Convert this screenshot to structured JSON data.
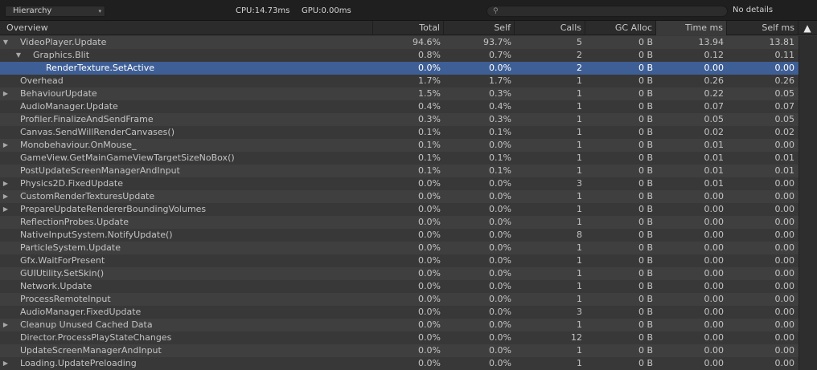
{
  "toolbar": {
    "view_mode": "Hierarchy",
    "cpu": "CPU:14.73ms",
    "gpu": "GPU:0.00ms",
    "search_value": "",
    "details": "No details"
  },
  "columns": {
    "overview": "Overview",
    "total": "Total",
    "self": "Self",
    "calls": "Calls",
    "gc_alloc": "GC Alloc",
    "time_ms": "Time ms",
    "self_ms": "Self ms"
  },
  "rows": [
    {
      "name": "VideoPlayer.Update",
      "depth": 0,
      "foldout": "expanded",
      "total": "94.6%",
      "self": "93.7%",
      "calls": "5",
      "gc": "0 B",
      "time": "13.94",
      "selfms": "13.81"
    },
    {
      "name": "Graphics.Blit",
      "depth": 1,
      "foldout": "expanded",
      "total": "0.8%",
      "self": "0.7%",
      "calls": "2",
      "gc": "0 B",
      "time": "0.12",
      "selfms": "0.11"
    },
    {
      "name": "RenderTexture.SetActive",
      "depth": 2,
      "foldout": "none",
      "total": "0.0%",
      "self": "0.0%",
      "calls": "2",
      "gc": "0 B",
      "time": "0.00",
      "selfms": "0.00",
      "selected": true
    },
    {
      "name": "Overhead",
      "depth": 0,
      "foldout": "none",
      "total": "1.7%",
      "self": "1.7%",
      "calls": "1",
      "gc": "0 B",
      "time": "0.26",
      "selfms": "0.26"
    },
    {
      "name": "BehaviourUpdate",
      "depth": 0,
      "foldout": "collapsed",
      "total": "1.5%",
      "self": "0.3%",
      "calls": "1",
      "gc": "0 B",
      "time": "0.22",
      "selfms": "0.05"
    },
    {
      "name": "AudioManager.Update",
      "depth": 0,
      "foldout": "none",
      "total": "0.4%",
      "self": "0.4%",
      "calls": "1",
      "gc": "0 B",
      "time": "0.07",
      "selfms": "0.07"
    },
    {
      "name": "Profiler.FinalizeAndSendFrame",
      "depth": 0,
      "foldout": "none",
      "total": "0.3%",
      "self": "0.3%",
      "calls": "1",
      "gc": "0 B",
      "time": "0.05",
      "selfms": "0.05"
    },
    {
      "name": "Canvas.SendWillRenderCanvases()",
      "depth": 0,
      "foldout": "none",
      "total": "0.1%",
      "self": "0.1%",
      "calls": "1",
      "gc": "0 B",
      "time": "0.02",
      "selfms": "0.02"
    },
    {
      "name": "Monobehaviour.OnMouse_",
      "depth": 0,
      "foldout": "collapsed",
      "total": "0.1%",
      "self": "0.0%",
      "calls": "1",
      "gc": "0 B",
      "time": "0.01",
      "selfms": "0.00"
    },
    {
      "name": "GameView.GetMainGameViewTargetSizeNoBox()",
      "depth": 0,
      "foldout": "none",
      "total": "0.1%",
      "self": "0.1%",
      "calls": "1",
      "gc": "0 B",
      "time": "0.01",
      "selfms": "0.01"
    },
    {
      "name": "PostUpdateScreenManagerAndInput",
      "depth": 0,
      "foldout": "none",
      "total": "0.1%",
      "self": "0.1%",
      "calls": "1",
      "gc": "0 B",
      "time": "0.01",
      "selfms": "0.01"
    },
    {
      "name": "Physics2D.FixedUpdate",
      "depth": 0,
      "foldout": "collapsed",
      "total": "0.0%",
      "self": "0.0%",
      "calls": "3",
      "gc": "0 B",
      "time": "0.01",
      "selfms": "0.00"
    },
    {
      "name": "CustomRenderTexturesUpdate",
      "depth": 0,
      "foldout": "collapsed",
      "total": "0.0%",
      "self": "0.0%",
      "calls": "1",
      "gc": "0 B",
      "time": "0.00",
      "selfms": "0.00"
    },
    {
      "name": "PrepareUpdateRendererBoundingVolumes",
      "depth": 0,
      "foldout": "collapsed",
      "total": "0.0%",
      "self": "0.0%",
      "calls": "1",
      "gc": "0 B",
      "time": "0.00",
      "selfms": "0.00"
    },
    {
      "name": "ReflectionProbes.Update",
      "depth": 0,
      "foldout": "none",
      "total": "0.0%",
      "self": "0.0%",
      "calls": "1",
      "gc": "0 B",
      "time": "0.00",
      "selfms": "0.00"
    },
    {
      "name": "NativeInputSystem.NotifyUpdate()",
      "depth": 0,
      "foldout": "none",
      "total": "0.0%",
      "self": "0.0%",
      "calls": "8",
      "gc": "0 B",
      "time": "0.00",
      "selfms": "0.00"
    },
    {
      "name": "ParticleSystem.Update",
      "depth": 0,
      "foldout": "none",
      "total": "0.0%",
      "self": "0.0%",
      "calls": "1",
      "gc": "0 B",
      "time": "0.00",
      "selfms": "0.00"
    },
    {
      "name": "Gfx.WaitForPresent",
      "depth": 0,
      "foldout": "none",
      "total": "0.0%",
      "self": "0.0%",
      "calls": "1",
      "gc": "0 B",
      "time": "0.00",
      "selfms": "0.00"
    },
    {
      "name": "GUIUtility.SetSkin()",
      "depth": 0,
      "foldout": "none",
      "total": "0.0%",
      "self": "0.0%",
      "calls": "1",
      "gc": "0 B",
      "time": "0.00",
      "selfms": "0.00"
    },
    {
      "name": "Network.Update",
      "depth": 0,
      "foldout": "none",
      "total": "0.0%",
      "self": "0.0%",
      "calls": "1",
      "gc": "0 B",
      "time": "0.00",
      "selfms": "0.00"
    },
    {
      "name": "ProcessRemoteInput",
      "depth": 0,
      "foldout": "none",
      "total": "0.0%",
      "self": "0.0%",
      "calls": "1",
      "gc": "0 B",
      "time": "0.00",
      "selfms": "0.00"
    },
    {
      "name": "AudioManager.FixedUpdate",
      "depth": 0,
      "foldout": "none",
      "total": "0.0%",
      "self": "0.0%",
      "calls": "3",
      "gc": "0 B",
      "time": "0.00",
      "selfms": "0.00"
    },
    {
      "name": "Cleanup Unused Cached Data",
      "depth": 0,
      "foldout": "collapsed",
      "total": "0.0%",
      "self": "0.0%",
      "calls": "1",
      "gc": "0 B",
      "time": "0.00",
      "selfms": "0.00"
    },
    {
      "name": "Director.ProcessPlayStateChanges",
      "depth": 0,
      "foldout": "none",
      "total": "0.0%",
      "self": "0.0%",
      "calls": "12",
      "gc": "0 B",
      "time": "0.00",
      "selfms": "0.00"
    },
    {
      "name": "UpdateScreenManagerAndInput",
      "depth": 0,
      "foldout": "none",
      "total": "0.0%",
      "self": "0.0%",
      "calls": "1",
      "gc": "0 B",
      "time": "0.00",
      "selfms": "0.00"
    },
    {
      "name": "Loading.UpdatePreloading",
      "depth": 0,
      "foldout": "collapsed",
      "total": "0.0%",
      "self": "0.0%",
      "calls": "1",
      "gc": "0 B",
      "time": "0.00",
      "selfms": "0.00"
    }
  ],
  "icons": {
    "expanded": "▼",
    "collapsed": "▶",
    "search": "⚲",
    "dropdown": "▾",
    "sort": "▲"
  },
  "colors": {
    "selection": "#3e5f96",
    "background": "#383838",
    "toolbar": "#1f1f1f"
  }
}
